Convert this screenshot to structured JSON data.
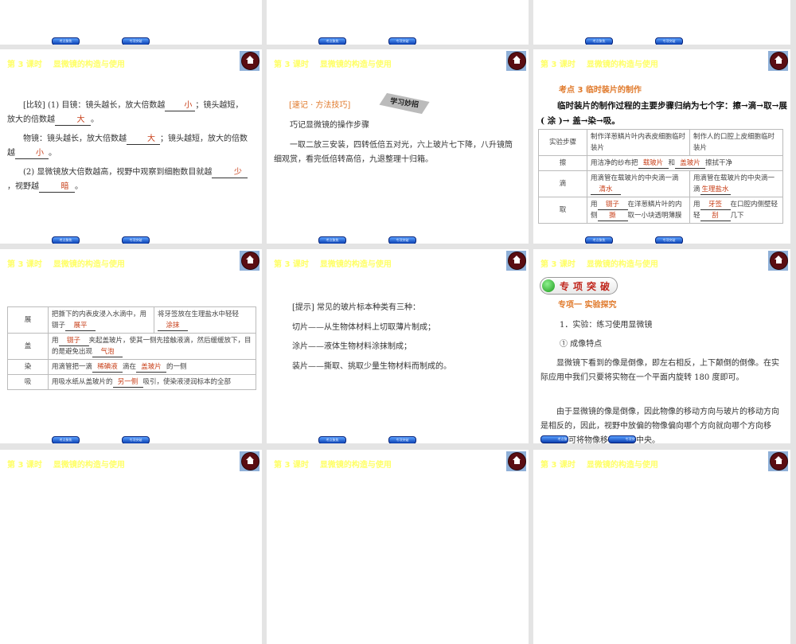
{
  "common": {
    "slide_title": "第 3 课时    显微镜的构造与使用",
    "nav_prev": "考点聚焦",
    "nav_next": "专项突破",
    "home_icon": "home-icon"
  },
  "slide_compare": {
    "p1_a": "[比较] (1) 目镜：镜头越长，放大倍数越",
    "p1_ans1": "小",
    "p1_b": "；镜头越短，放大的倍数越",
    "p1_ans2": "大",
    "p1_end": "。",
    "p2_a": "物镜：镜头越长，放大倍数越",
    "p2_ans1": "大",
    "p2_b": "；镜头越短，放大的倍数越",
    "p2_ans2": "小",
    "p2_end": "。",
    "p3_a": "(2) 显微镜放大倍数越高，视野中观察到细胞数目就越",
    "p3_ans1": "少",
    "p3_b": "，视野越",
    "p3_ans2": "暗",
    "p3_end": "。"
  },
  "slide_tips": {
    "heading": "[速记 · 方法技巧]",
    "sticker": "学习妙招",
    "subtitle": "巧记显微镜的操作步骤",
    "body": "一取二放三安装，四转低倍五对光，六上玻片七下降，八升镜筒细观赏，看完低倍转高倍，九退整理十归箱。"
  },
  "slide_steps": {
    "heading": "考点 3    临时装片的制作",
    "intro": "临时装片的制作过程的主要步骤归纳为七个字：擦→滴→取→展 ( 涂 )→ 盖→染→吸。",
    "headers": [
      "实验步骤",
      "制作洋葱鳞片叶内表皮细胞临时装片",
      "制作人的口腔上皮细胞临时装片"
    ],
    "ca_1": "用洁净的纱布把",
    "ca_ans1": "载玻片",
    "ca_2": "和",
    "ca_ans2": "盖玻片",
    "ca_3": "擦拭干净",
    "di_l": "用滴管在载玻片的中央滴一滴",
    "di_l_ans": "清水",
    "di_r": "用滴管在载玻片的中央滴一滴",
    "di_r_ans": "生理盐水",
    "qu_l1": "用",
    "qu_l_ans1": "镊子",
    "qu_l2": "在洋葱鳞片叶的内侧",
    "qu_l_ans2": "撕",
    "qu_l3": "取一小块透明薄膜",
    "qu_r1": "用",
    "qu_r_ans1": "牙签",
    "qu_r2": "在口腔内侧壁轻轻",
    "qu_r_ans2": "刮",
    "qu_r3": "几下",
    "row_labels": [
      "擦",
      "滴",
      "取"
    ]
  },
  "slide_steps2": {
    "row_labels": [
      "展",
      "盖",
      "染",
      "吸"
    ],
    "zhan_l": "把撕下的内表皮浸入水滴中，用镊子",
    "zhan_l_ans": "展平",
    "zhan_r": "将牙签放在生理盐水中轻轻",
    "zhan_r_ans": "涂抹",
    "gai_1": "用",
    "gai_ans1": "镊子",
    "gai_2": "夹起盖玻片，使其一侧先接触液滴，然后缓缓放下，目的是避免出现",
    "gai_ans2": "气泡",
    "ran_1": "用滴管把一滴",
    "ran_ans1": "稀碘液",
    "ran_2": "滴在",
    "ran_ans2": "盖玻片",
    "ran_3": "的一侧",
    "xi_1": "用吸水纸从盖玻片的",
    "xi_ans": "另一侧",
    "xi_2": "吸引，使染液浸润标本的全部"
  },
  "slide_hint": {
    "lines": [
      "[提示]  常见的玻片标本种类有三种：",
      "切片——从生物体材料上切取薄片制成；",
      "涂片——液体生物材料涂抹制成；",
      "装片——撕取、挑取少量生物材料而制成的。"
    ]
  },
  "slide_special": {
    "badge": "专项突破",
    "heading": "专项一    实验探究",
    "item1": "1．实验：练习使用显微镜",
    "item2": "① 成像特点",
    "para1": "显微镜下看到的像是倒像，即左右相反，上下颠倒的倒像。在实际应用中我们只要将实物在一个平面内旋转 180 度即可。",
    "para2_a": "由于显微镜的像是倒像，因此物像的移动方向与玻片的移动方向是相反的，因此，视野中放偏的物像偏向哪个方向就向哪个方向移",
    "para2_b": "可将物像移",
    "para2_c": "中央。"
  }
}
